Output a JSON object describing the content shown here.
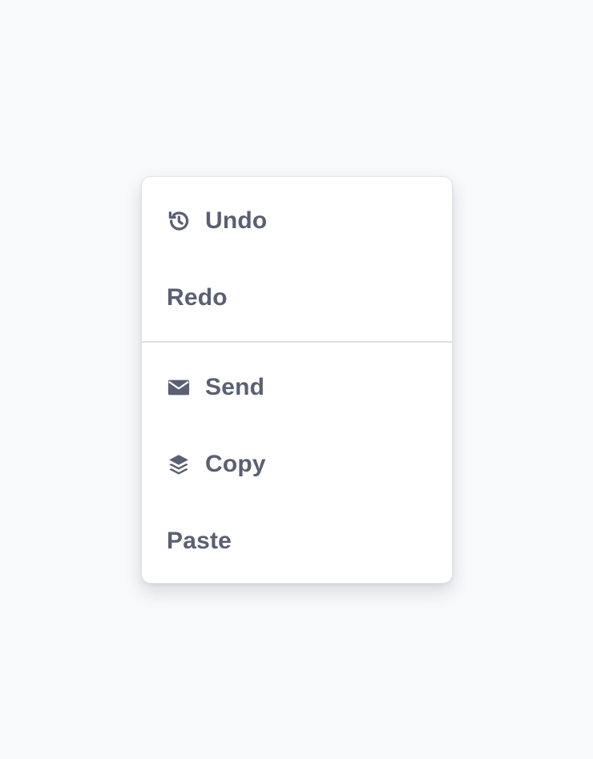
{
  "colors": {
    "background": "#f8f9fb",
    "menu_background": "#ffffff",
    "text": "#5a6072",
    "divider": "#dcdfe4"
  },
  "menu": {
    "groups": [
      {
        "items": [
          {
            "label": "Undo",
            "icon": "history-icon"
          },
          {
            "label": "Redo",
            "icon": null
          }
        ]
      },
      {
        "items": [
          {
            "label": "Send",
            "icon": "envelope-icon"
          },
          {
            "label": "Copy",
            "icon": "layers-icon"
          },
          {
            "label": "Paste",
            "icon": null
          }
        ]
      }
    ]
  }
}
